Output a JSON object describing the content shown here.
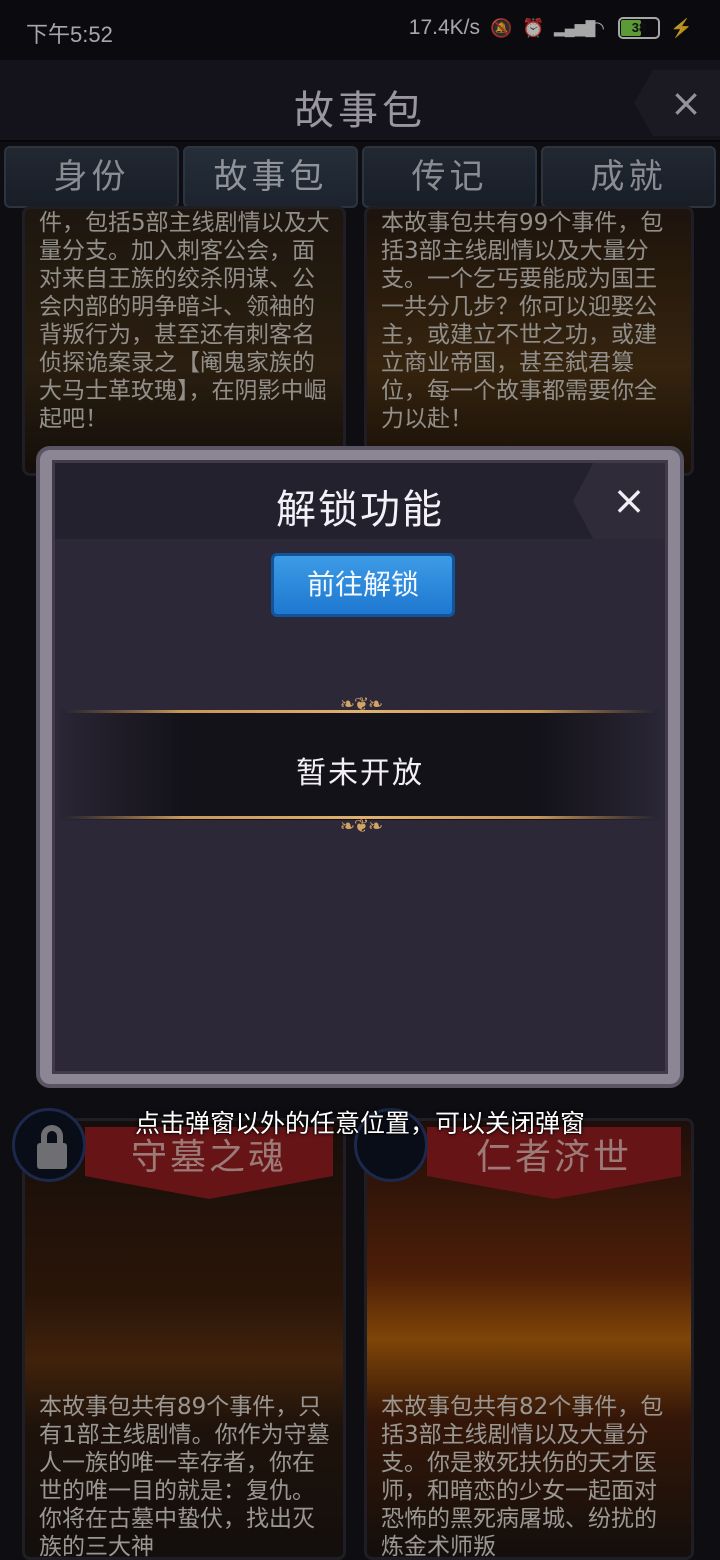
{
  "status_bar": {
    "time": "下午5:52",
    "network_speed": "17.4K/s",
    "battery": "38",
    "icons": [
      "mute-icon",
      "alarm-icon",
      "signal-icon",
      "wifi-icon",
      "battery-icon",
      "charging-icon"
    ]
  },
  "header": {
    "title": "故事包",
    "close_icon": "×"
  },
  "tabs": [
    {
      "label": "身份"
    },
    {
      "label": "故事包"
    },
    {
      "label": "传记"
    },
    {
      "label": "成就"
    }
  ],
  "cards": {
    "top_left_desc": "件，包括5部主线剧情以及大量分支。加入刺客公会，面对来自王族的绞杀阴谋、公会内部的明争暗斗、领袖的背叛行为，甚至还有刺客名侦探诡案录之【阉鬼家族的大马士革玫瑰】，在阴影中崛起吧！",
    "top_right_desc": "本故事包共有99个事件，包括3部主线剧情以及大量分支。一个乞丐要能成为国王一共分几步？你可以迎娶公主，或建立不世之功，或建立商业帝国，甚至弑君篡位，每一个故事都需要你全力以赴！",
    "bottom_left": {
      "title": "守墓之魂",
      "desc": "本故事包共有89个事件，只有1部主线剧情。你作为守墓人一族的唯一幸存者，你在世的唯一目的就是：复仇。你将在古墓中蛰伏，找出灭族的三大神"
    },
    "bottom_right": {
      "title": "仁者济世",
      "desc": "本故事包共有82个事件，包括3部主线剧情以及大量分支。你是救死扶伤的天才医师，和暗恋的少女一起面对恐怖的黑死病屠城、纷扰的炼金术师叛"
    }
  },
  "modal": {
    "title": "解锁功能",
    "close_icon": "×",
    "unlock_button": "前往解锁",
    "status_text": "暂未开放",
    "ornament": "❧❦❧"
  },
  "hint": "点击弹窗以外的任意位置，可以关闭弹窗"
}
